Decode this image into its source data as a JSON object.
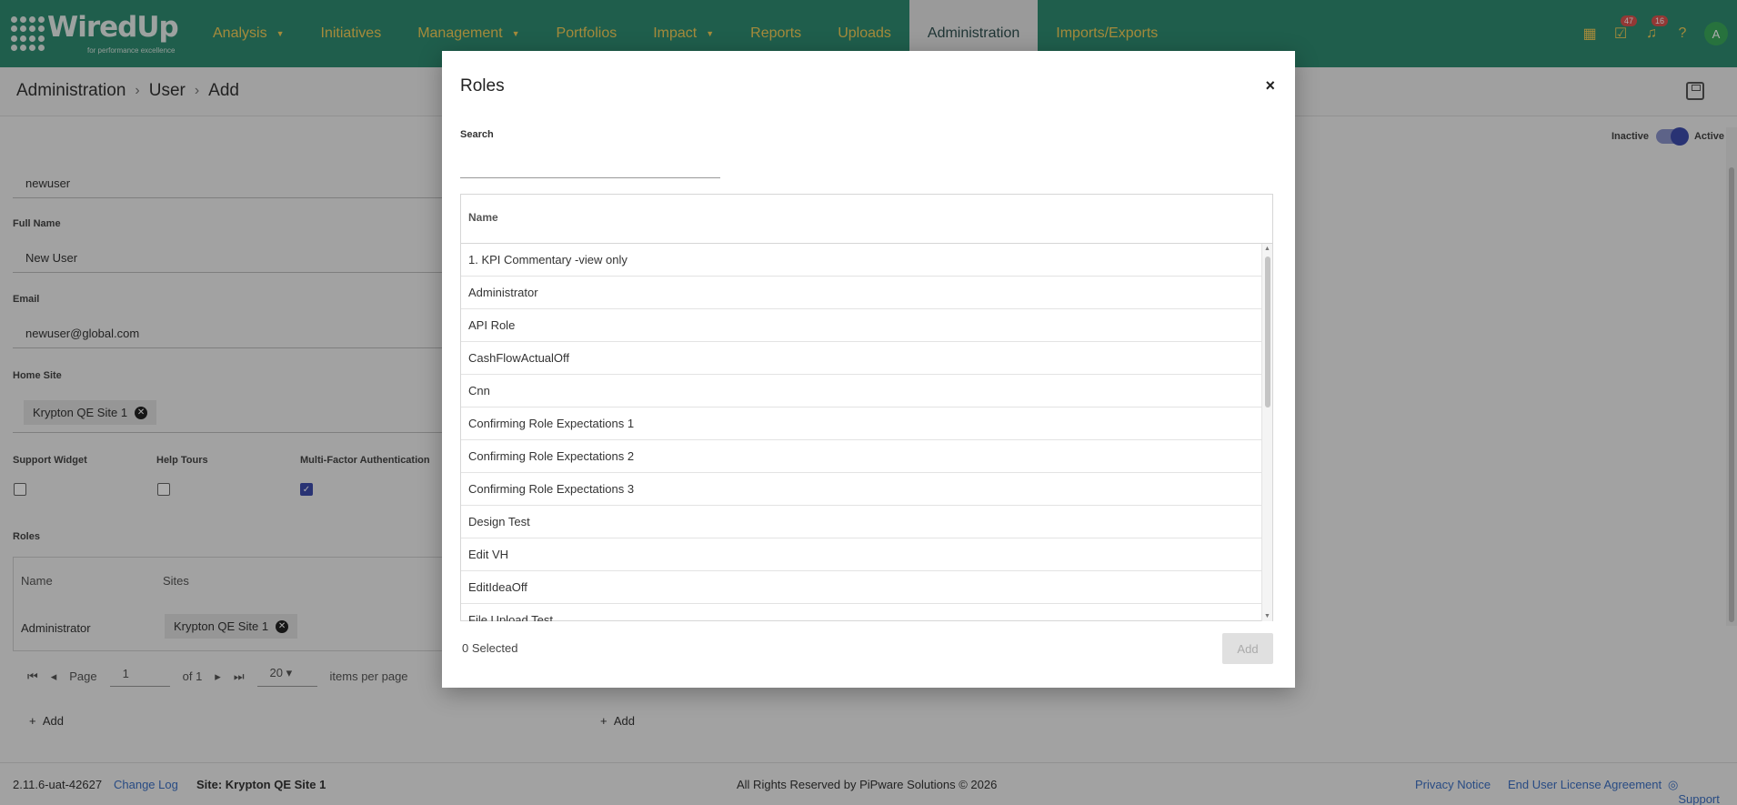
{
  "brand": {
    "name": "WiredUp",
    "tagline": "for performance excellence"
  },
  "nav": {
    "items": [
      {
        "label": "Analysis",
        "dropdown": true
      },
      {
        "label": "Initiatives",
        "dropdown": false
      },
      {
        "label": "Management",
        "dropdown": true
      },
      {
        "label": "Portfolios",
        "dropdown": false
      },
      {
        "label": "Impact",
        "dropdown": true
      },
      {
        "label": "Reports",
        "dropdown": false
      },
      {
        "label": "Uploads",
        "dropdown": false
      },
      {
        "label": "Administration",
        "dropdown": false,
        "active": true
      },
      {
        "label": "Imports/Exports",
        "dropdown": false
      }
    ],
    "tasks_badge": "47",
    "notifications_badge": "16",
    "avatar_initial": "A"
  },
  "breadcrumb": {
    "level1": "Administration",
    "level2": "User",
    "level3": "Add"
  },
  "status_toggle": {
    "off_label": "Inactive",
    "on_label": "Active"
  },
  "form": {
    "username_value": "newuser",
    "full_name_label": "Full Name",
    "full_name_value": "New User",
    "email_label": "Email",
    "email_value": "newuser@global.com",
    "home_site_label": "Home Site",
    "home_site_chip": "Krypton QE Site 1",
    "support_widget_label": "Support Widget",
    "help_tours_label": "Help Tours",
    "mfa_label": "Multi-Factor Authentication",
    "roles_label": "Roles",
    "roles_table": {
      "col_name": "Name",
      "col_sites": "Sites",
      "row_name": "Administrator",
      "row_site_chip": "Krypton QE Site 1"
    },
    "pager": {
      "page_label": "Page",
      "page_value": "1",
      "of_label": "of 1",
      "per_page_value": "20",
      "per_page_label": "items per page"
    },
    "add_label": "Add"
  },
  "footer": {
    "version": "2.11.6-uat-42627",
    "changelog": "Change Log",
    "site": "Site: Krypton QE Site 1",
    "copyright": "All Rights Reserved by PiPware Solutions © 2026",
    "privacy": "Privacy Notice",
    "eula": "End User License Agreement",
    "support": "Support"
  },
  "modal": {
    "title": "Roles",
    "close": "×",
    "search_label": "Search",
    "search_value": "",
    "column_header": "Name",
    "rows": [
      "1. KPI Commentary -view only",
      "Administrator",
      "API Role",
      "CashFlowActualOff",
      "Cnn",
      "Confirming Role Expectations 1",
      "Confirming Role Expectations 2",
      "Confirming Role Expectations 3",
      "Design Test",
      "Edit VH",
      "EditIdeaOff",
      "File Upload Test"
    ],
    "selected_count": "0 Selected",
    "add_button": "Add"
  }
}
